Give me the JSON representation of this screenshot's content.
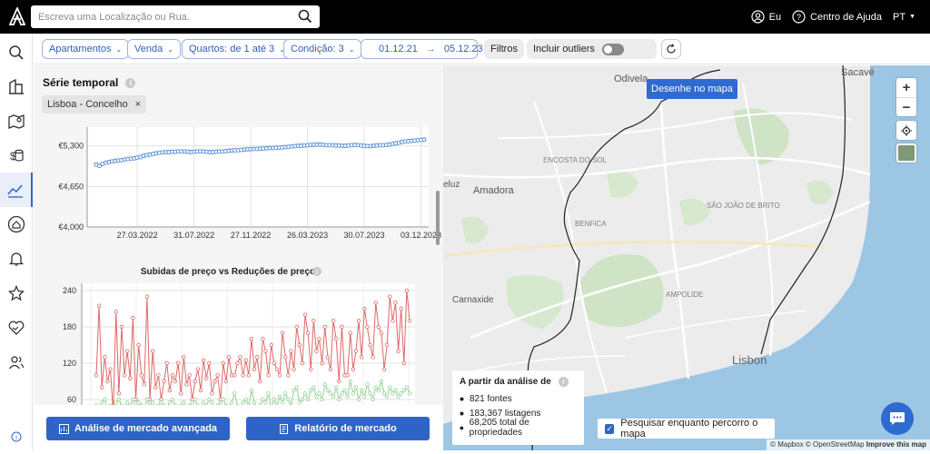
{
  "search": {
    "placeholder": "Escreva uma Localização ou Rua."
  },
  "header": {
    "user_label": "Eu",
    "help_label": "Centro de Ajuda",
    "lang_label": "PT"
  },
  "filters": {
    "property_type": "Apartamentos",
    "operation": "Venda",
    "rooms": "Quartos: de 1 até 3",
    "condition": "Condição: 3",
    "date_from": "01.12.21",
    "date_arrow": "→",
    "date_to": "05.12.23",
    "filters_label": "Filtros",
    "outliers_label": "Incluir outliers"
  },
  "panel": {
    "title": "Série temporal",
    "tag": "Lisboa - Concelho",
    "tag_close": "×"
  },
  "chart_data": [
    {
      "type": "line",
      "title": "",
      "ylabel": "",
      "xlabel": "",
      "ylim": [
        4000,
        5600
      ],
      "y_ticks": [
        "€4,000",
        "€4,650",
        "€5,300"
      ],
      "y_tick_values": [
        4000,
        4650,
        5300
      ],
      "x_ticks": [
        "27.03.2022",
        "31.07.2022",
        "27.11.2022",
        "26.03.2023",
        "30.07.2023",
        "03.12.2023"
      ],
      "x_tick_index": [
        13,
        31,
        49,
        67,
        85,
        103
      ],
      "grid": true,
      "color": "#4a86cf",
      "series": [
        {
          "values": [
            5000,
            4980,
            5010,
            5030,
            5040,
            5050,
            5060,
            5065,
            5070,
            5080,
            5090,
            5095,
            5100,
            5110,
            5120,
            5140,
            5150,
            5160,
            5170,
            5180,
            5190,
            5195,
            5200,
            5200,
            5205,
            5205,
            5210,
            5210,
            5210,
            5205,
            5200,
            5205,
            5210,
            5210,
            5210,
            5205,
            5200,
            5200,
            5205,
            5210,
            5210,
            5215,
            5220,
            5225,
            5230,
            5230,
            5235,
            5240,
            5245,
            5245,
            5250,
            5250,
            5255,
            5255,
            5260,
            5265,
            5265,
            5270,
            5270,
            5275,
            5280,
            5285,
            5290,
            5295,
            5300,
            5300,
            5305,
            5310,
            5315,
            5315,
            5320,
            5320,
            5315,
            5310,
            5310,
            5310,
            5305,
            5305,
            5300,
            5300,
            5305,
            5310,
            5315,
            5310,
            5305,
            5300,
            5295,
            5295,
            5300,
            5305,
            5310,
            5310,
            5315,
            5320,
            5330,
            5340,
            5350,
            5360,
            5370,
            5375,
            5380,
            5385,
            5390,
            5395,
            5400
          ]
        }
      ]
    },
    {
      "type": "line",
      "title": "Subidas de preço vs Reduções de preço",
      "xlabel": "",
      "ylabel": "",
      "ylim": [
        30,
        250
      ],
      "y_ticks": [
        "60",
        "120",
        "180",
        "240"
      ],
      "y_tick_values": [
        60,
        120,
        180,
        240
      ],
      "grid": true,
      "series": [
        {
          "color": "#e06666",
          "values": [
            100,
            215,
            80,
            130,
            90,
            110,
            40,
            205,
            70,
            180,
            100,
            140,
            95,
            195,
            60,
            150,
            100,
            85,
            230,
            60,
            140,
            80,
            100,
            60,
            90,
            120,
            75,
            100,
            90,
            120,
            70,
            130,
            85,
            100,
            60,
            90,
            110,
            75,
            125,
            95,
            120,
            70,
            90,
            100,
            60,
            120,
            90,
            130,
            100,
            100,
            120,
            130,
            100,
            125,
            100,
            160,
            110,
            130,
            90,
            160,
            140,
            100,
            150,
            120,
            110,
            100,
            170,
            130,
            100,
            140,
            110,
            180,
            150,
            120,
            200,
            170,
            110,
            190,
            140,
            160,
            120,
            180,
            130,
            110,
            190,
            160,
            90,
            180,
            100,
            100,
            170,
            110,
            140,
            190,
            130,
            210,
            180,
            150,
            130,
            220,
            180,
            170,
            110,
            150,
            230,
            190,
            220,
            140,
            210,
            120,
            240,
            190
          ]
        },
        {
          "color": "#8fd18f",
          "values": [
            50,
            40,
            55,
            60,
            45,
            50,
            45,
            55,
            60,
            50,
            45,
            55,
            50,
            60,
            45,
            55,
            50,
            45,
            60,
            50,
            55,
            45,
            50,
            55,
            50,
            45,
            55,
            60,
            50,
            45,
            50,
            55,
            45,
            50,
            55,
            60,
            50,
            45,
            55,
            50,
            60,
            55,
            45,
            50,
            55,
            60,
            50,
            45,
            55,
            70,
            50,
            45,
            55,
            60,
            50,
            75,
            55,
            45,
            50,
            60,
            55,
            70,
            45,
            60,
            50,
            65,
            55,
            70,
            60,
            50,
            75,
            80,
            55,
            60,
            70,
            60,
            75,
            80,
            65,
            70,
            60,
            85,
            75,
            70,
            65,
            80,
            60,
            70,
            75,
            65,
            90,
            70,
            80,
            60,
            75,
            65,
            85,
            70,
            60,
            80,
            75,
            90,
            70,
            65,
            80,
            70,
            75,
            65,
            70,
            75,
            80,
            70
          ]
        }
      ]
    }
  ],
  "buttons": {
    "advanced": "Análise de mercado avançada",
    "report": "Relatório de mercado"
  },
  "map": {
    "draw_button": "Desenhe no mapa",
    "zoom_in": "+",
    "zoom_out": "−",
    "analysis_title": "A partir da análise de",
    "sources": "821 fontes",
    "listings": "183,367 listagens",
    "properties": "68,205 total de propriedades",
    "search_move": "Pesquisar enquanto percorro o mapa",
    "attribution_mapbox": "© Mapbox",
    "attribution_osm": "© OpenStreetMap",
    "attribution_improve": "Improve this map",
    "labels": {
      "odivelas": "Odivela",
      "sacavem": "Sacavé",
      "amadora": "Amadora",
      "carnaxide": "Carnaxide",
      "lisbon": "Lisbon",
      "benfica": "BENFICA",
      "campolide": "AMPOLIDE",
      "luz": "eluz",
      "encosta": "ENCOSTA DO SOL",
      "sao_joao": "SÃO JOÃO DE BRITO"
    }
  }
}
